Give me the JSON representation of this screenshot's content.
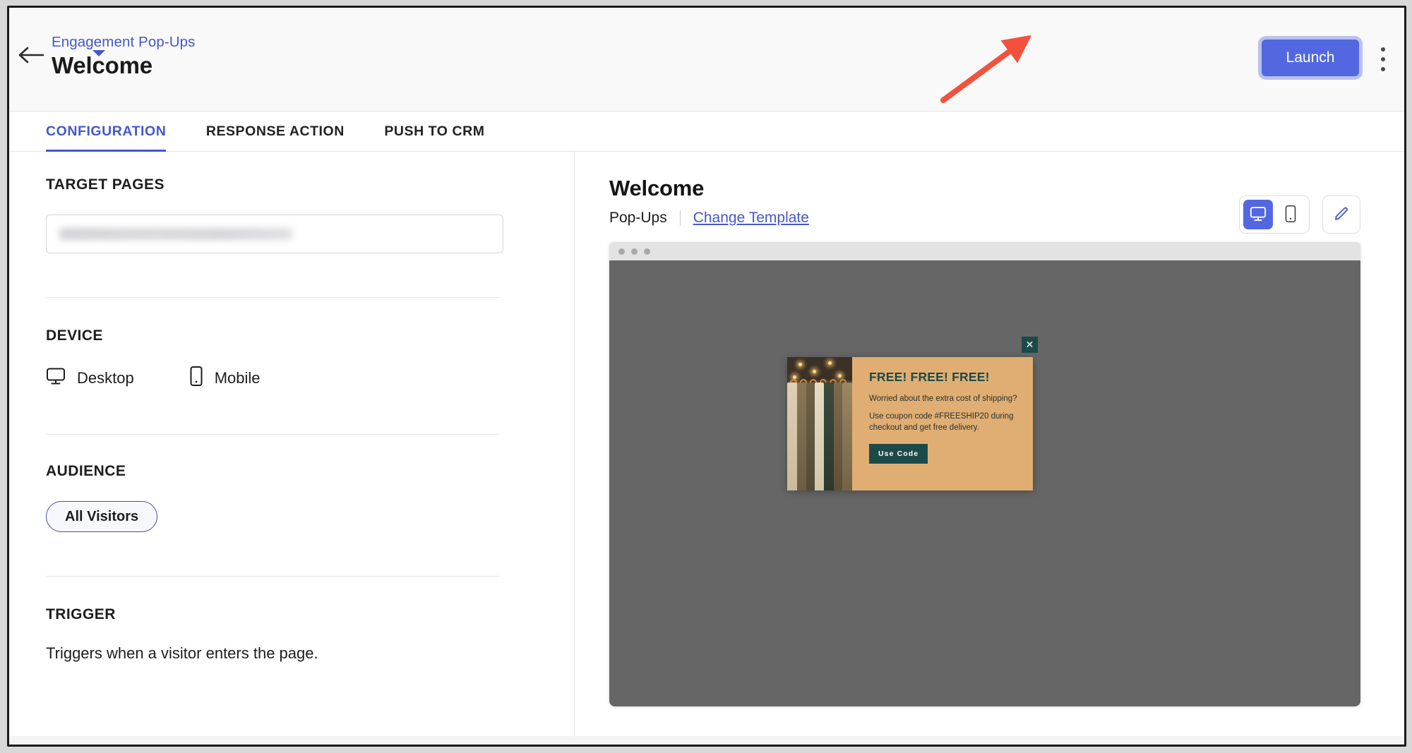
{
  "header": {
    "back_icon": "arrow-left-icon",
    "breadcrumb": "Engagement Pop-Ups",
    "title": "Welcome",
    "launch_label": "Launch",
    "kebab_icon": "more-vertical-icon"
  },
  "tabs": [
    {
      "label": "CONFIGURATION",
      "active": true
    },
    {
      "label": "RESPONSE ACTION",
      "active": false
    },
    {
      "label": "PUSH TO CRM",
      "active": false
    }
  ],
  "configuration": {
    "target_pages": {
      "label": "TARGET PAGES",
      "value": "",
      "placeholder": ""
    },
    "device": {
      "label": "DEVICE",
      "options": [
        {
          "label": "Desktop",
          "icon": "monitor-icon"
        },
        {
          "label": "Mobile",
          "icon": "smartphone-icon"
        }
      ]
    },
    "audience": {
      "label": "AUDIENCE",
      "selected": "All Visitors"
    },
    "trigger": {
      "label": "TRIGGER",
      "description": "Triggers when a visitor enters the page."
    }
  },
  "preview": {
    "title": "Welcome",
    "type": "Pop-Ups",
    "change_template": "Change Template",
    "view_toggle": [
      {
        "icon": "monitor-icon",
        "name": "desktop-view",
        "active": true
      },
      {
        "icon": "smartphone-icon",
        "name": "mobile-view",
        "active": false
      }
    ],
    "edit_icon": "pencil-icon",
    "browser_dots": 3
  },
  "popup": {
    "close_label": "✕",
    "headline": "FREE! FREE! FREE!",
    "body_line_1": "Worried about the extra cost of shipping?",
    "body_line_2": "Use coupon code #FREESHIP20 during checkout and get free delivery.",
    "cta_label": "Use Code",
    "image_alt": "clothing-rack-photo"
  },
  "colors": {
    "accent": "#4558c9",
    "launch_button": "#5368e0",
    "popup_bg": "#e0ae72",
    "popup_dark": "#1d4a49",
    "annotation": "#f4513c",
    "preview_backdrop": "#666666"
  },
  "annotation": {
    "type": "arrow",
    "points_to": "launch-button"
  }
}
